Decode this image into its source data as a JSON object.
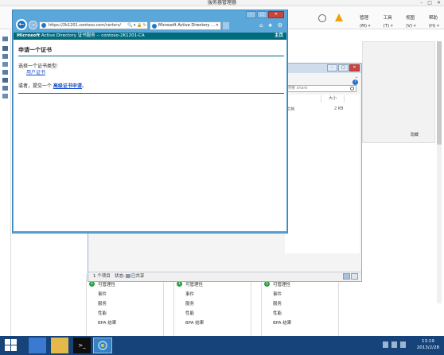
{
  "server_manager": {
    "title": "服务器管理器",
    "menu": [
      "管理(M)",
      "工具(T)",
      "视图(V)",
      "帮助(H)"
    ],
    "hide_label": "隐藏",
    "tiles": [
      {
        "rows": [
          "可管理性",
          "事件",
          "服务",
          "性能",
          "BPA 结果"
        ]
      },
      {
        "rows": [
          "可管理性",
          "事件",
          "服务",
          "性能",
          "BPA 结果"
        ]
      },
      {
        "rows": [
          "可管理性",
          "事件",
          "服务",
          "性能",
          "BPA 结果"
        ]
      }
    ]
  },
  "explorer": {
    "search_placeholder": "搜索 share",
    "column_size": "大小",
    "file_type": "文档",
    "file_size": "2 KB",
    "status_count": "1 个项目",
    "status_state_prefix": "状态:",
    "status_state_value": "已共享"
  },
  "ie": {
    "address": "https://2k1201.contoso.com/certsrv/",
    "tab_title": "Microsoft Active Directory ...",
    "cert_header_brand": "Microsoft",
    "cert_header_rest": " Active Directory 证书服务  --  contoso-2K1201-CA",
    "home_link": "主页",
    "page_title": "申请一个证书",
    "select_type": "选择一个证书类型:",
    "user_cert_link": "用户证书",
    "or_prefix": "或者，提交一个 ",
    "advanced_link": "高级证书申请",
    "or_suffix": "。"
  },
  "taskbar": {
    "time": "13:19",
    "date": "2013/2/28"
  },
  "colors": {
    "taskbar": "#16437a",
    "ie_frame": "#5ca7d9",
    "cert_header": "#006b7a",
    "link": "#1a4fc9"
  }
}
